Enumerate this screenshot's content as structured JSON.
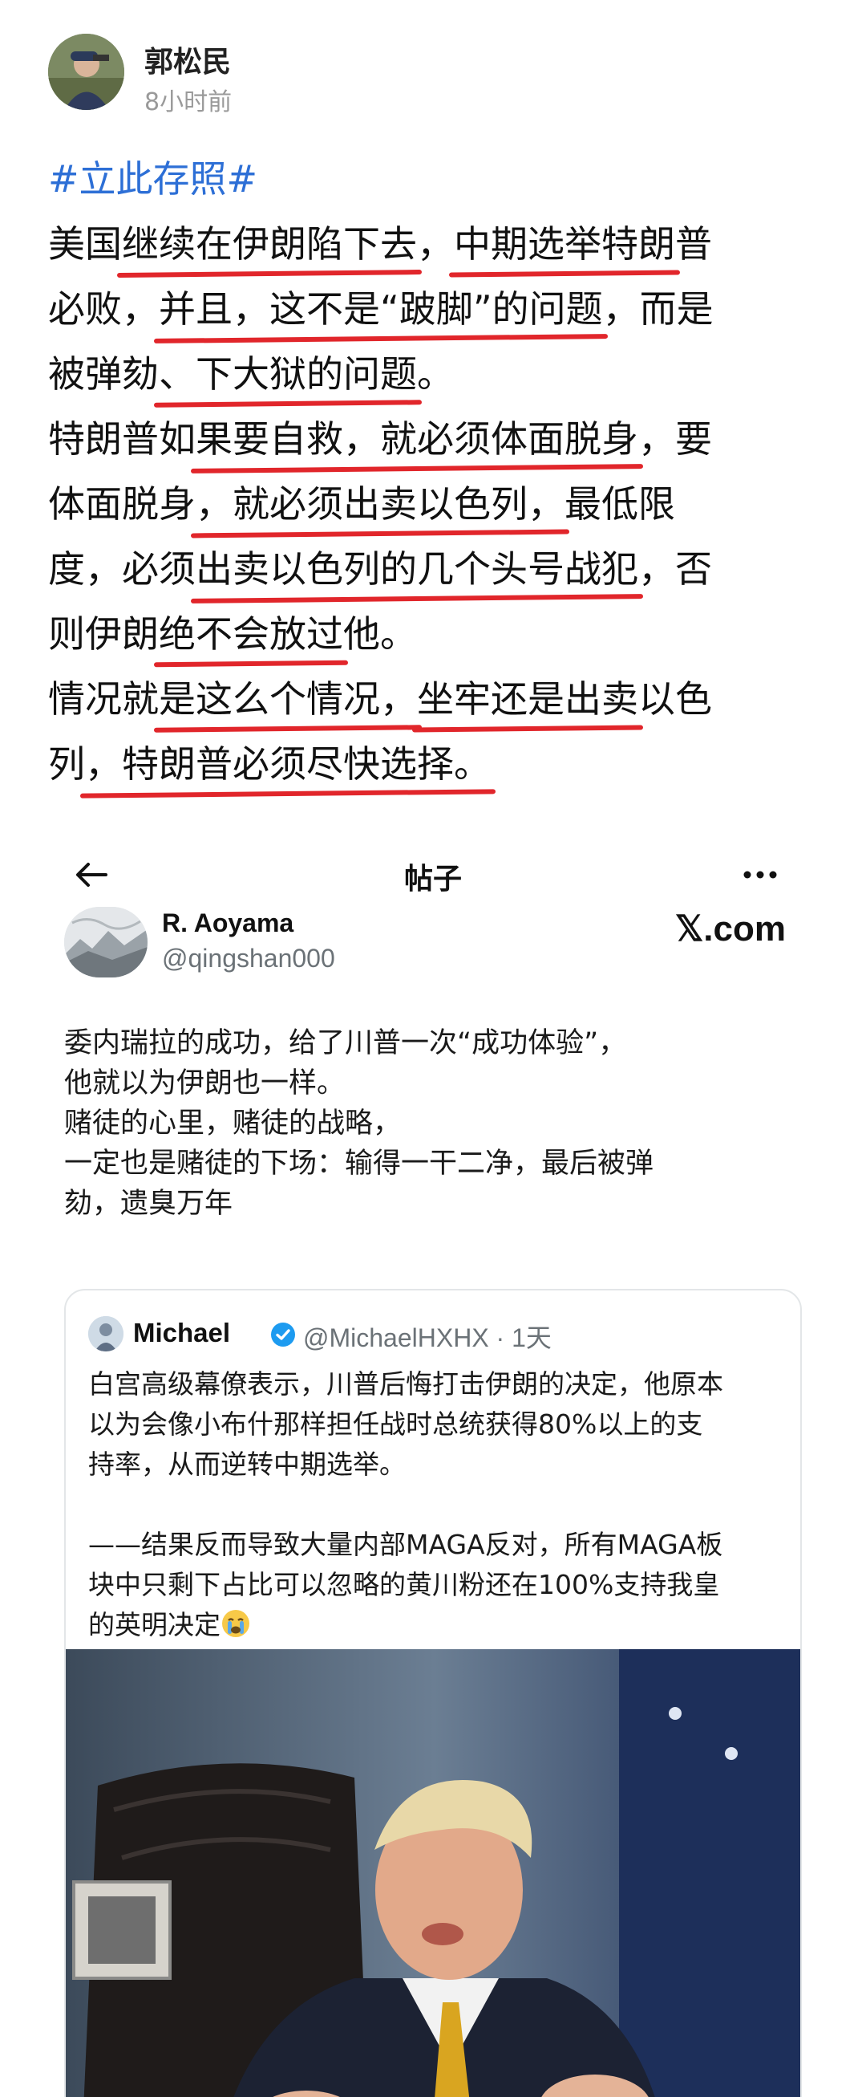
{
  "post": {
    "author": "郭松民",
    "time": "8小时前",
    "hashtag": "#立此存照#",
    "lines": [
      [
        {
          "t": "美国"
        },
        {
          "t": "继续在伊朗陷下去",
          "u": true
        },
        {
          "t": "，"
        },
        {
          "t": "中期选举特朗",
          "u": true
        },
        {
          "t": "普"
        }
      ],
      [
        {
          "t": "必败，"
        },
        {
          "t": "并且，这不是“跛脚”的问题",
          "u": true
        },
        {
          "t": "，而是"
        }
      ],
      [
        {
          "t": "被弹劾"
        },
        {
          "t": "、下大狱的问题",
          "u": true
        },
        {
          "t": "。"
        }
      ],
      [
        {
          "t": "特朗普如"
        },
        {
          "t": "果要自救，就必须体面脱身",
          "u": true
        },
        {
          "t": "，要"
        }
      ],
      [
        {
          "t": "体面脱身"
        },
        {
          "t": "，就必须出卖以色列，",
          "u": true
        },
        {
          "t": "最低限"
        }
      ],
      [
        {
          "t": "度，必须"
        },
        {
          "t": "出卖以色列的几个头号战犯",
          "u": true
        },
        {
          "t": "，否"
        }
      ],
      [
        {
          "t": "则伊朗"
        },
        {
          "t": "绝不会放过",
          "u": true
        },
        {
          "t": "他。"
        }
      ],
      [
        {
          "t": "情况就"
        },
        {
          "t": "是这么个情况，",
          "u": true
        },
        {
          "t": "坐牢还是出卖",
          "u": true
        },
        {
          "t": "以色"
        }
      ],
      [
        {
          "t": "列"
        },
        {
          "t": "，特朗普必须尽快选择。",
          "u": true
        }
      ]
    ]
  },
  "screenshot": {
    "nav_title": "帖子",
    "icons": {
      "back": "back-arrow-icon",
      "more": "more-dots-icon"
    },
    "tweet": {
      "name": "R. Aoyama",
      "handle": "@qingshan000",
      "site": "𝕏.com",
      "lines": [
        "委内瑞拉的成功，给了川普一次“成功体验”，",
        "他就以为伊朗也一样。",
        "赌徒的心里，赌徒的战略，",
        "一定也是赌徒的下场：输得一干二净，最后被弹",
        "劾，遗臭万年"
      ]
    },
    "quote": {
      "name": "Michael",
      "handle": "@MichaelHXHX · 1天",
      "lines": [
        "白宫高级幕僚表示，川普后悔打击伊朗的决定，他原本",
        "以为会像小布什那样担任战时总统获得80%以上的支",
        "持率，从而逆转中期选举。",
        "",
        "——结果反而导致大量内部MAGA反对，所有MAGA板",
        "块中只剩下占比可以忽略的黄川粉还在100%支持我皇",
        "的英明决定"
      ]
    }
  },
  "colors": {
    "hashtag": "#2d6fd6",
    "underline": "#e1262b",
    "verified": "#1d9bf0",
    "handle": "#6b7277"
  }
}
